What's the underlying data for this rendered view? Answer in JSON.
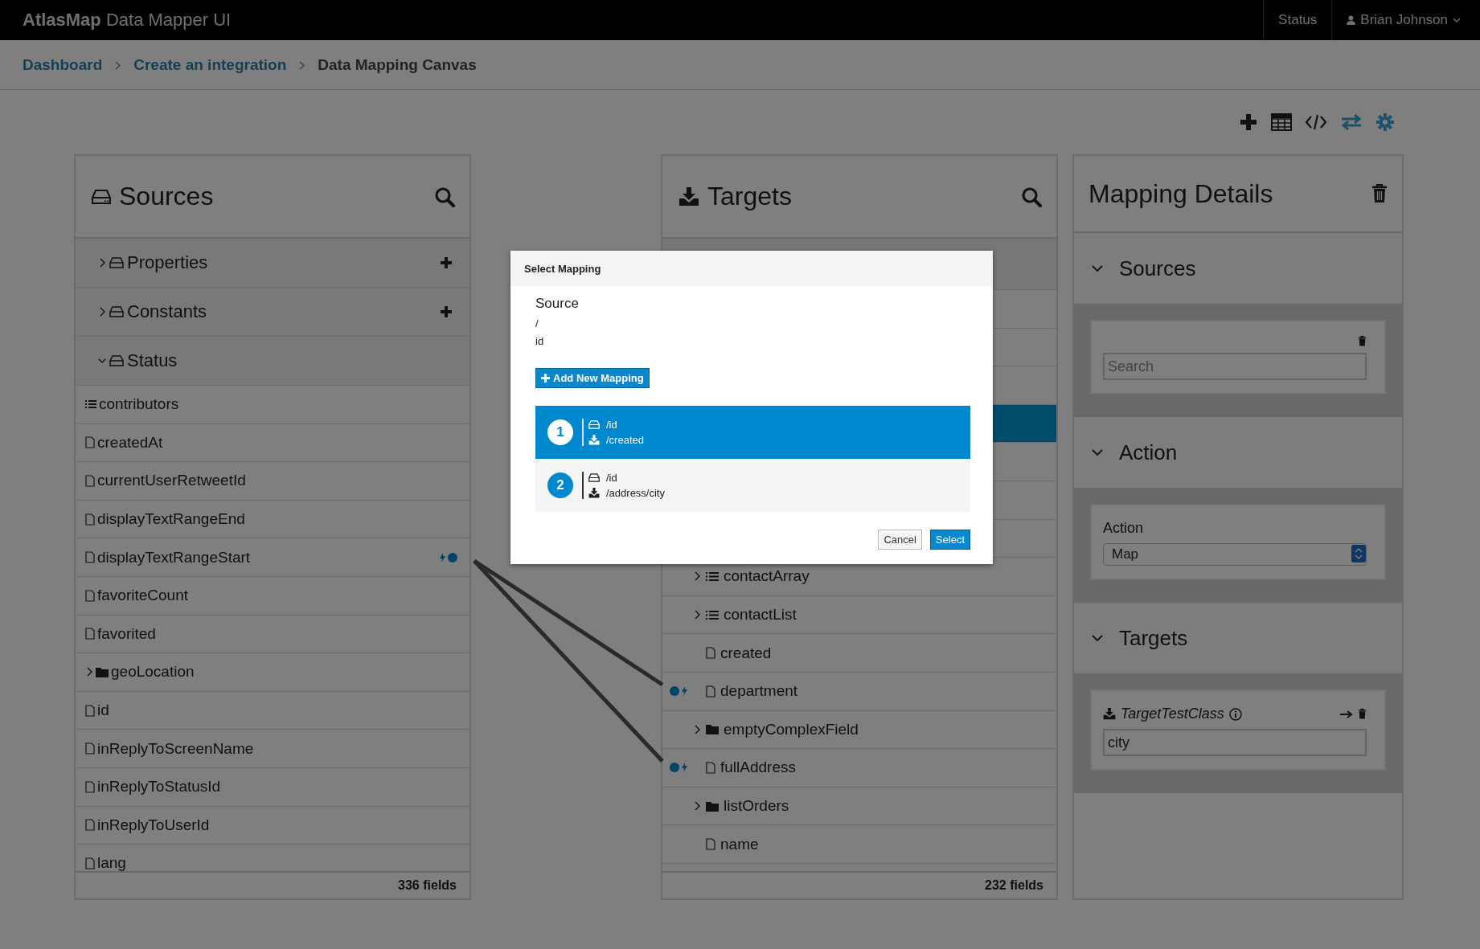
{
  "app": {
    "brand": "AtlasMap",
    "title": "Data Mapper UI",
    "status_link": "Status",
    "user": "Brian Johnson"
  },
  "breadcrumbs": [
    {
      "label": "Dashboard",
      "link": true
    },
    {
      "label": "Create an integration",
      "link": true
    },
    {
      "label": "Data Mapping Canvas",
      "link": false
    }
  ],
  "sources": {
    "title": "Sources",
    "sections": [
      {
        "label": "Properties",
        "expanded": false,
        "addable": true
      },
      {
        "label": "Constants",
        "expanded": false,
        "addable": true
      },
      {
        "label": "Status",
        "expanded": true,
        "addable": false
      }
    ],
    "fields": [
      {
        "label": "contributors",
        "kind": "list",
        "mapped": false
      },
      {
        "label": "createdAt",
        "kind": "field",
        "mapped": false
      },
      {
        "label": "currentUserRetweetId",
        "kind": "field",
        "mapped": false
      },
      {
        "label": "displayTextRangeEnd",
        "kind": "field",
        "mapped": false
      },
      {
        "label": "displayTextRangeStart",
        "kind": "field",
        "mapped": true
      },
      {
        "label": "favoriteCount",
        "kind": "field",
        "mapped": false
      },
      {
        "label": "favorited",
        "kind": "field",
        "mapped": false
      },
      {
        "label": "geoLocation",
        "kind": "folder",
        "mapped": false
      },
      {
        "label": "id",
        "kind": "field",
        "mapped": false
      },
      {
        "label": "inReplyToScreenName",
        "kind": "field",
        "mapped": false
      },
      {
        "label": "inReplyToStatusId",
        "kind": "field",
        "mapped": false
      },
      {
        "label": "inReplyToUserId",
        "kind": "field",
        "mapped": false
      },
      {
        "label": "lang",
        "kind": "field",
        "mapped": false
      }
    ],
    "count": "336 fields"
  },
  "targets": {
    "title": "Targets",
    "covered_rows": [
      {
        "selected": false
      },
      {
        "selected": false
      },
      {
        "selected": false
      },
      {
        "selected": true
      },
      {
        "selected": false
      },
      {
        "selected": false
      },
      {
        "selected": false
      }
    ],
    "fields": [
      {
        "label": "contactArray",
        "kind": "list-group",
        "mapped": false
      },
      {
        "label": "contactList",
        "kind": "list-group",
        "mapped": false
      },
      {
        "label": "created",
        "kind": "field",
        "mapped": false
      },
      {
        "label": "department",
        "kind": "field",
        "mapped": true
      },
      {
        "label": "emptyComplexField",
        "kind": "folder",
        "mapped": false
      },
      {
        "label": "fullAddress",
        "kind": "field",
        "mapped": true
      },
      {
        "label": "listOrders",
        "kind": "folder",
        "mapped": false
      },
      {
        "label": "name",
        "kind": "field",
        "mapped": false
      }
    ],
    "count": "232 fields"
  },
  "details": {
    "title": "Mapping Details",
    "sources_header": "Sources",
    "search_placeholder": "Search",
    "action_header": "Action",
    "action_label": "Action",
    "action_value": "Map",
    "targets_header": "Targets",
    "target_class": "TargetTestClass",
    "target_value": "city"
  },
  "modal": {
    "title": "Select Mapping",
    "source_heading": "Source",
    "source_path": "/",
    "source_field": "id",
    "add_button": "Add New Mapping",
    "mappings": [
      {
        "number": "1",
        "source": "/id",
        "target": "/created",
        "selected": true
      },
      {
        "number": "2",
        "source": "/id",
        "target": "/address/city",
        "selected": false
      }
    ],
    "cancel": "Cancel",
    "select": "Select"
  }
}
